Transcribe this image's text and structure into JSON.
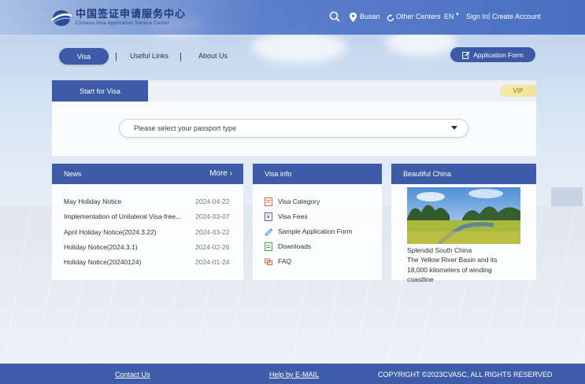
{
  "header": {
    "logo_cn": "中国签证申请服务中心",
    "logo_en": "Chinese Visa Application Service Center",
    "city": "Busan",
    "other_centers": "Other Centers",
    "lang": "EN",
    "sign_in": "Sign In",
    "separator": "|",
    "create_account": "Create Account"
  },
  "nav": {
    "visa": "Visa",
    "sep": "|",
    "useful_links": "Useful Links",
    "about_us": "About Us",
    "application_form": "Application Form"
  },
  "start": {
    "tab": "Start for Visa",
    "vip": "VIP",
    "passport_placeholder": "Please select your passport type"
  },
  "news": {
    "title": "News",
    "more": "More",
    "items": [
      {
        "title": "May Holiday Notice",
        "date": "2024-04-22"
      },
      {
        "title": "Implementation of Unilateral Visa-free...",
        "date": "2024-03-07"
      },
      {
        "title": "April Holiday Notice(2024.3.22)",
        "date": "2024-03-22"
      },
      {
        "title": "Holiday Notice(2024.3.1)",
        "date": "2024-02-26"
      },
      {
        "title": "Holiday Notice(20240124)",
        "date": "2024-01-24"
      }
    ]
  },
  "visa_info": {
    "title": "Visa info",
    "items": [
      {
        "label": "Visa Category",
        "icon": "category-icon"
      },
      {
        "label": "Visa Fees",
        "icon": "fees-icon"
      },
      {
        "label": "Sample Application Form",
        "icon": "form-icon"
      },
      {
        "label": "Downloads",
        "icon": "download-icon"
      },
      {
        "label": "FAQ",
        "icon": "faq-icon"
      }
    ]
  },
  "beautiful_china": {
    "title": "Beautiful China",
    "caption_1": "Splendid South China",
    "caption_2": "The Yellow River Basin and its 18,000 kilometers of winding coastline"
  },
  "footer": {
    "contact": "Contact Us",
    "help": "Help by E-MAIL",
    "copyright": "COPYRIGHT ©2023CVASC, ALL RIGHTS RESERVED"
  },
  "colors": {
    "primary": "#3c5aa6",
    "header": "#4a70c4",
    "vip": "#f6e9a8"
  }
}
